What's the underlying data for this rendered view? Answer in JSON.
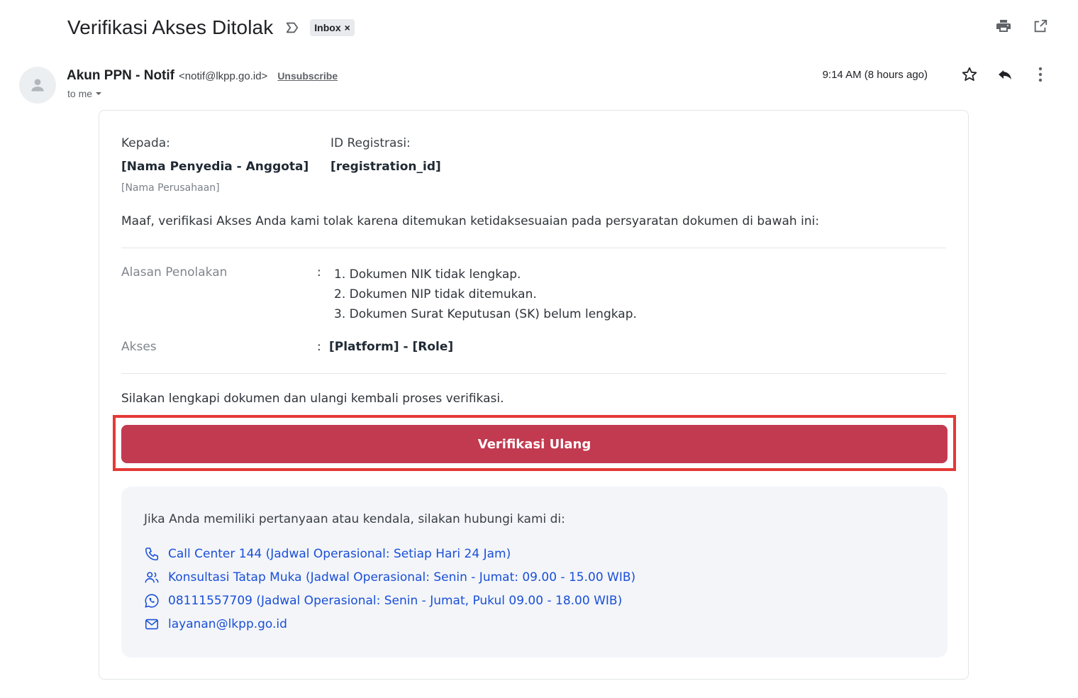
{
  "header": {
    "subject": "Verifikasi Akses Ditolak",
    "label_chip": "Inbox",
    "label_chip_close": "×"
  },
  "sender": {
    "name": "Akun PPN - Notif",
    "email": "<notif@lkpp.go.id>",
    "unsubscribe": "Unsubscribe",
    "recipient": "to me",
    "timestamp": "9:14 AM (8 hours ago)"
  },
  "email": {
    "to_label": "Kepada:",
    "to_name": "[Nama Penyedia - Anggota]",
    "to_company": "[Nama Perusahaan]",
    "reg_label": "ID Registrasi:",
    "reg_value": "[registration_id]",
    "intro": "Maaf, verifikasi Akses Anda kami tolak karena ditemukan ketidaksesuaian pada persyaratan dokumen di bawah ini:",
    "reason_label": "Alasan Penolakan",
    "colon": ":",
    "reasons": [
      "1. Dokumen NIK tidak lengkap.",
      "2. Dokumen NIP tidak ditemukan.",
      "3. Dokumen Surat Keputusan (SK) belum lengkap."
    ],
    "access_label": "Akses",
    "access_value": "[Platform] - [Role]",
    "closing": "Silakan lengkapi dokumen dan ulangi kembali proses verifikasi.",
    "cta": "Verifikasi Ulang"
  },
  "contact": {
    "intro": "Jika Anda memiliki pertanyaan atau kendala, silakan hubungi kami di:",
    "items": [
      {
        "icon": "phone-icon",
        "text": "Call Center 144 (Jadwal Operasional: Setiap Hari 24 Jam)"
      },
      {
        "icon": "users-icon",
        "text": "Konsultasi Tatap Muka (Jadwal Operasional: Senin - Jumat: 09.00 - 15.00 WIB)"
      },
      {
        "icon": "whatsapp-icon",
        "text": "08111557709 (Jadwal Operasional: Senin - Jumat, Pukul 09.00 - 18.00 WIB)"
      },
      {
        "icon": "mail-icon",
        "text": "layanan@lkpp.go.id"
      }
    ],
    "link_color": "#1a4fd6"
  },
  "colors": {
    "cta": "#c23a50",
    "highlight": "#e53935"
  }
}
